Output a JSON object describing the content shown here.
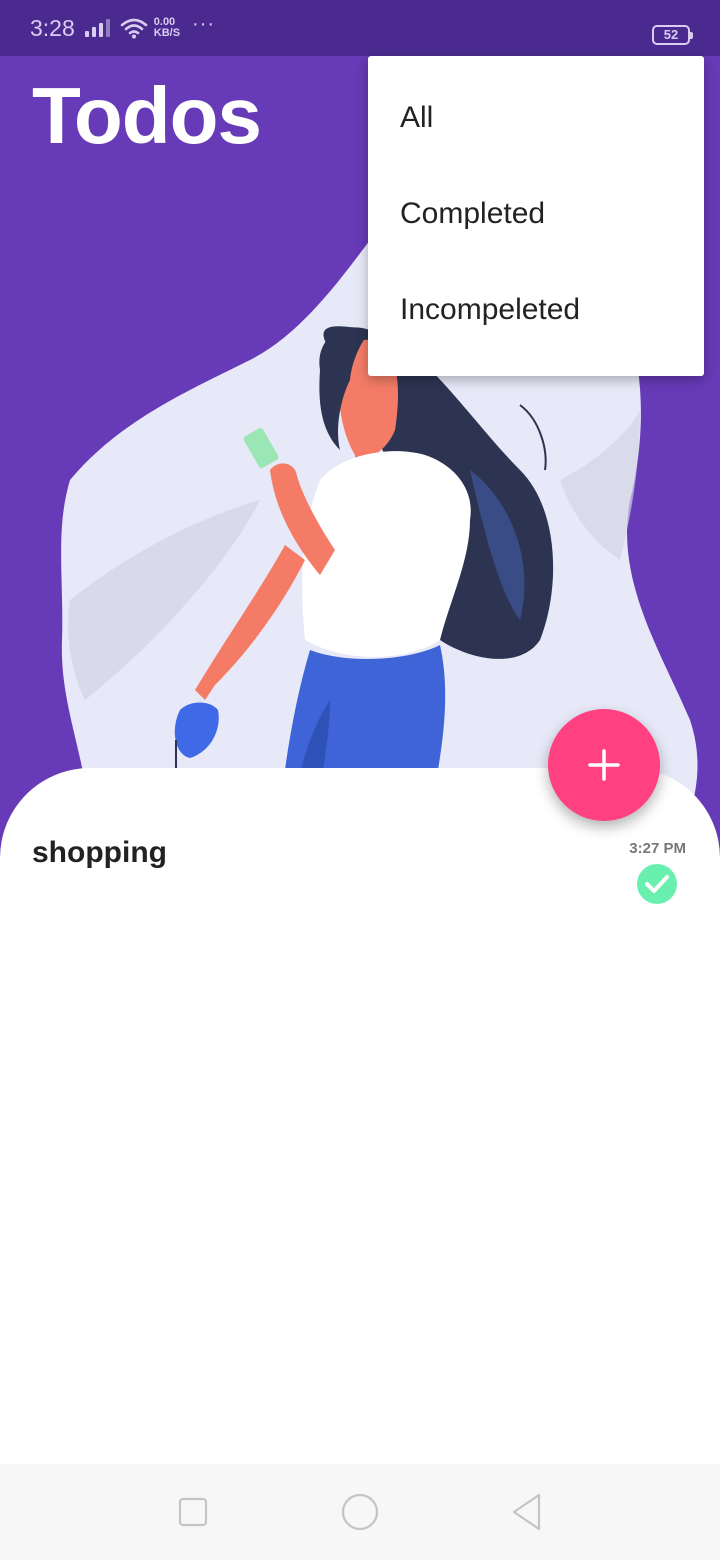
{
  "status_bar": {
    "time": "3:28",
    "net_speed_value": "0.00",
    "net_speed_unit": "KB/S",
    "more": "···",
    "battery": "52",
    "icons": [
      "signal-icon",
      "wifi-icon",
      "battery-icon"
    ]
  },
  "header": {
    "title": "Todos"
  },
  "filter_menu": {
    "items": [
      {
        "label": "All"
      },
      {
        "label": "Completed"
      },
      {
        "label": "Incompeleted"
      }
    ]
  },
  "todos": [
    {
      "title": "shopping",
      "time": "3:27 PM",
      "completed": true
    }
  ],
  "fab": {
    "icon": "plus-icon"
  },
  "nav_bar": {
    "icons": [
      "recent-apps-icon",
      "home-icon",
      "back-icon"
    ]
  },
  "colors": {
    "primary": "#673ab7",
    "status_bar": "#4a2a8e",
    "accent": "#ff4081",
    "check": "#69f0ae",
    "blob": "#e8e9f8"
  }
}
